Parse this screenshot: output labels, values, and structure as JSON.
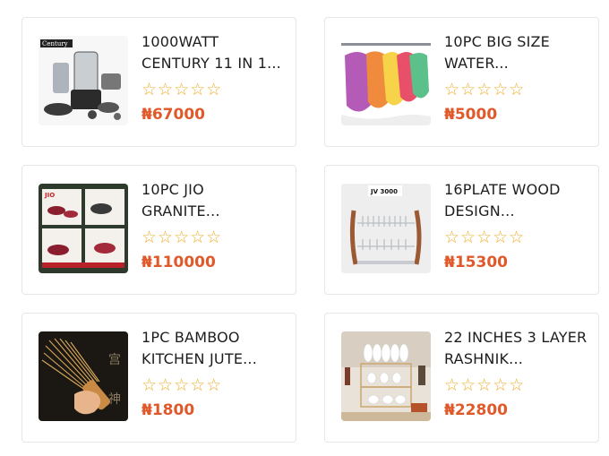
{
  "products": [
    {
      "name": "1000WATT CENTURY 11 IN 1...",
      "rating_stars": "☆☆☆☆☆",
      "price": "₦67000",
      "image_icon": "food-processor-image",
      "image_text": "Century"
    },
    {
      "name": "10PC BIG SIZE WATER...",
      "rating_stars": "☆☆☆☆☆",
      "price": "₦5000",
      "image_icon": "hanging-towels-image"
    },
    {
      "name": "10PC JIO GRANITE...",
      "rating_stars": "☆☆☆☆☆",
      "price": "₦110000",
      "image_icon": "cookware-set-image",
      "image_text": "JIO"
    },
    {
      "name": "16PLATE WOOD DESIGN...",
      "rating_stars": "☆☆☆☆☆",
      "price": "₦15300",
      "image_icon": "dish-rack-image",
      "image_text": "JV 3000"
    },
    {
      "name": "1PC BAMBOO KITCHEN JUTE...",
      "rating_stars": "☆☆☆☆☆",
      "price": "₦1800",
      "image_icon": "bamboo-whisk-image"
    },
    {
      "name": "22 INCHES 3 LAYER RASHNIK...",
      "rating_stars": "☆☆☆☆☆",
      "price": "₦22800",
      "image_icon": "plate-rack-image"
    }
  ],
  "colors": {
    "price": "#e0592a",
    "stars": "#f0ad2e",
    "border": "#e6e6e6"
  }
}
